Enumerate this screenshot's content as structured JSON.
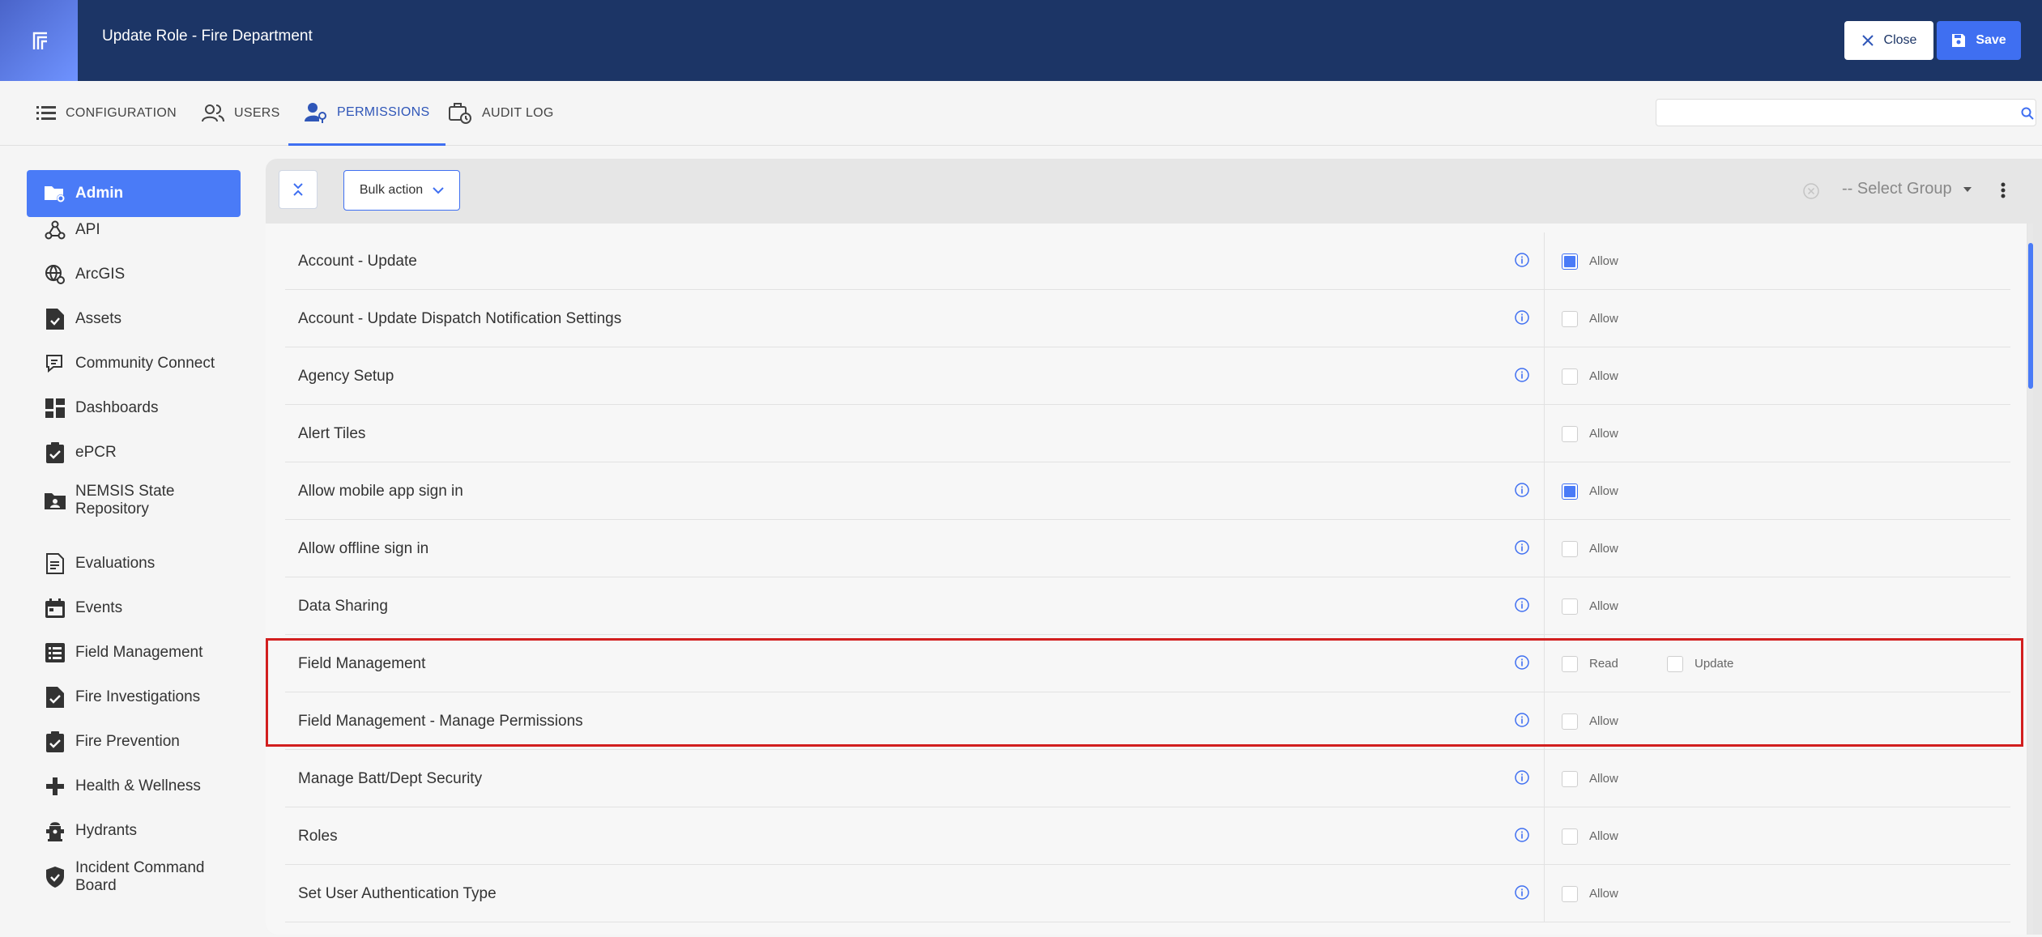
{
  "header": {
    "title": "Update Role - Fire Department",
    "close_label": "Close",
    "save_label": "Save"
  },
  "tabs": [
    {
      "label": "CONFIGURATION",
      "icon": "list-icon"
    },
    {
      "label": "USERS",
      "icon": "users-icon"
    },
    {
      "label": "PERMISSIONS",
      "icon": "user-key-icon",
      "active": true
    },
    {
      "label": "AUDIT LOG",
      "icon": "audit-log-icon"
    }
  ],
  "search": {
    "value": "",
    "placeholder": ""
  },
  "sidebar": {
    "items": [
      {
        "label": "Admin",
        "icon": "folder-gear-icon",
        "active": true
      },
      {
        "label": "API",
        "icon": "webhook-icon"
      },
      {
        "label": "ArcGIS",
        "icon": "globe-gear-icon"
      },
      {
        "label": "Assets",
        "icon": "document-check-icon"
      },
      {
        "label": "Community Connect",
        "icon": "chat-icon"
      },
      {
        "label": "Dashboards",
        "icon": "dashboard-icon"
      },
      {
        "label": "ePCR",
        "icon": "clipboard-check-icon"
      },
      {
        "label": "NEMSIS State Repository",
        "icon": "folder-user-icon"
      },
      {
        "label": "Evaluations",
        "icon": "document-list-icon"
      },
      {
        "label": "Events",
        "icon": "calendar-icon"
      },
      {
        "label": "Field Management",
        "icon": "form-list-icon"
      },
      {
        "label": "Fire Investigations",
        "icon": "clipboard-check-icon"
      },
      {
        "label": "Fire Prevention",
        "icon": "clipboard-check-icon"
      },
      {
        "label": "Health & Wellness",
        "icon": "plus-icon"
      },
      {
        "label": "Hydrants",
        "icon": "hydrant-icon"
      },
      {
        "label": "Incident Command Board",
        "icon": "shield-check-icon"
      }
    ]
  },
  "toolbar": {
    "bulk_action_label": "Bulk action",
    "select_group_label": "-- Select Group"
  },
  "permissions": [
    {
      "name": "Account - Update",
      "info": true,
      "options": [
        {
          "label": "Allow",
          "checked": true
        }
      ]
    },
    {
      "name": "Account - Update Dispatch Notification Settings",
      "info": true,
      "options": [
        {
          "label": "Allow",
          "checked": false
        }
      ]
    },
    {
      "name": "Agency Setup",
      "info": true,
      "options": [
        {
          "label": "Allow",
          "checked": false
        }
      ]
    },
    {
      "name": "Alert Tiles",
      "info": false,
      "options": [
        {
          "label": "Allow",
          "checked": false
        }
      ]
    },
    {
      "name": "Allow mobile app sign in",
      "info": true,
      "options": [
        {
          "label": "Allow",
          "checked": true
        }
      ]
    },
    {
      "name": "Allow offline sign in",
      "info": true,
      "options": [
        {
          "label": "Allow",
          "checked": false
        }
      ]
    },
    {
      "name": "Data Sharing",
      "info": true,
      "options": [
        {
          "label": "Allow",
          "checked": false
        }
      ]
    },
    {
      "name": "Field Management",
      "info": true,
      "options": [
        {
          "label": "Read",
          "checked": false
        },
        {
          "label": "Update",
          "checked": false
        }
      ]
    },
    {
      "name": "Field Management - Manage Permissions",
      "info": true,
      "options": [
        {
          "label": "Allow",
          "checked": false
        }
      ]
    },
    {
      "name": "Manage Batt/Dept Security",
      "info": true,
      "options": [
        {
          "label": "Allow",
          "checked": false
        }
      ]
    },
    {
      "name": "Roles",
      "info": true,
      "options": [
        {
          "label": "Allow",
          "checked": false
        }
      ]
    },
    {
      "name": "Set User Authentication Type",
      "info": true,
      "options": [
        {
          "label": "Allow",
          "checked": false
        }
      ]
    }
  ],
  "colors": {
    "header_bg": "#1c3566",
    "accent": "#3f6ff1",
    "highlight": "#d21f1f"
  }
}
